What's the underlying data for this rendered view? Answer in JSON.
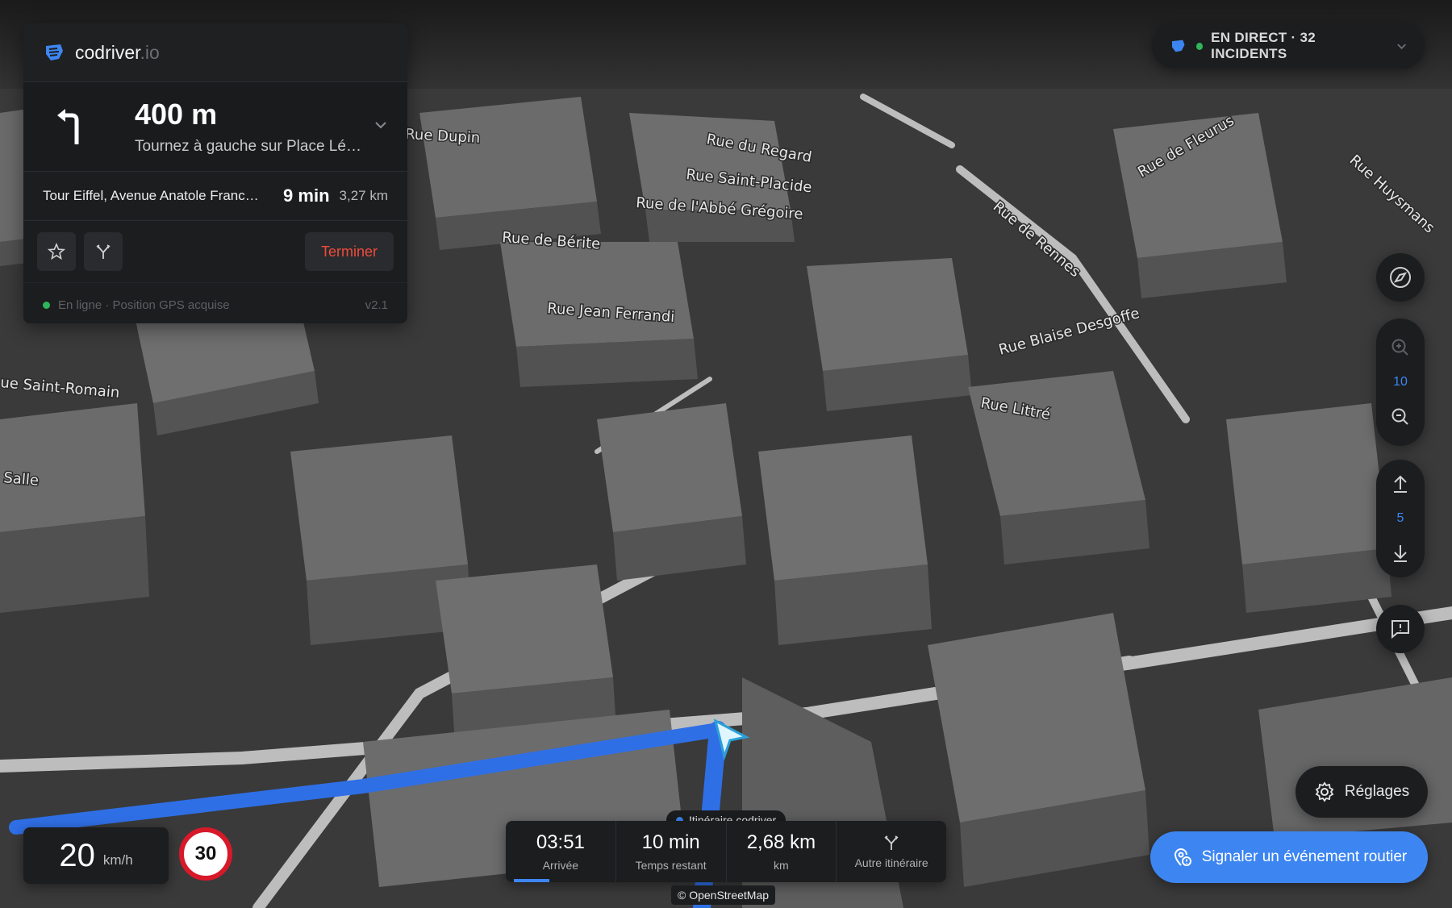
{
  "brand": {
    "name": "codriver",
    "tld": ".io"
  },
  "guidance": {
    "distance": "400 m",
    "instruction": "Tournez à gauche sur Place Lé…",
    "destination": "Tour Eiffel, Avenue Anatole Franc…",
    "eta": "9 min",
    "route_distance": "3,27 km",
    "end_label": "Terminer"
  },
  "status": {
    "text": "En ligne · Position GPS acquise",
    "version": "v2.1"
  },
  "live": {
    "label": "EN DIRECT · 32 INCIDENTS"
  },
  "controls": {
    "zoom_level": "10",
    "tilt_level": "5"
  },
  "speed": {
    "value": "20",
    "unit": "km/h",
    "limit": "30"
  },
  "trip": {
    "route_label": "Itinéraire codriver",
    "arrival_value": "03:51",
    "arrival_label": "Arrivée",
    "remaining_value": "10 min",
    "remaining_label": "Temps restant",
    "distance_value": "2,68 km",
    "distance_label": "km",
    "alt_label": "Autre itinéraire",
    "progress": 0.08
  },
  "attribution": "© OpenStreetMap",
  "settings_label": "Réglages",
  "report_label": "Signaler un événement routier",
  "streets": [
    "Rue Dupin",
    "Rue du Regard",
    "Rue Saint-Placide",
    "Rue de l'Abbé Grégoire",
    "Rue de Bérite",
    "Rue Jean Ferrandi",
    "Rue de Rennes",
    "Rue de Fleurus",
    "Rue Huysmans",
    "Rue Blaise Desgoffe",
    "Rue Littré",
    "ue Saint-Romain",
    "Salle"
  ],
  "colors": {
    "accent": "#3d86f2",
    "danger": "#ef4b3c",
    "online": "#2fb55a",
    "panel": "#1c1d1f"
  }
}
